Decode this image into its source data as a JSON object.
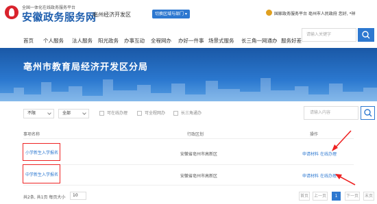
{
  "header": {
    "logo_small": "全国一体化在线政务服务平台",
    "logo_big": "安徽政务服务网",
    "region": "亳州经济开发区",
    "switch_label": "切换区域与部门",
    "top_links": "国家政务服务平台  亳州市人民政府  您好,  *祥"
  },
  "nav": {
    "items": [
      "首页",
      "个人服务",
      "法人服务",
      "阳光政务",
      "办事互动",
      "全程网办",
      "办好一件事",
      "场景式服务",
      "长三角一网通办",
      "服务好差"
    ],
    "search_placeholder": "请输入关键字"
  },
  "banner": {
    "title": "亳州市教育局经济开发区分局"
  },
  "filters": {
    "select1": "不限",
    "select2": "全部",
    "checkboxes": [
      "可在线办理",
      "可全程网办",
      "长三角通办"
    ],
    "search_placeholder": "请输入内容"
  },
  "table": {
    "headers": [
      "事项名称",
      "行政区划",
      "操作"
    ],
    "rows": [
      {
        "name": "小学新生入学报名",
        "area": "安徽省亳州市高新区",
        "actions": [
          "申请材料",
          "在线办理"
        ]
      },
      {
        "name": "中学新生入学报名",
        "area": "安徽省亳州市高新区",
        "actions": [
          "申请材料",
          "在线办理"
        ]
      }
    ]
  },
  "pager": {
    "info": "共2条, 共1页  每页大小",
    "page_size": "10",
    "buttons": [
      "首页",
      "上一页",
      "1",
      "下一页",
      "末页"
    ]
  },
  "colors": {
    "brand_blue": "#2d78d0",
    "annotation_red": "#e22222",
    "logo_red": "#d9232d"
  }
}
